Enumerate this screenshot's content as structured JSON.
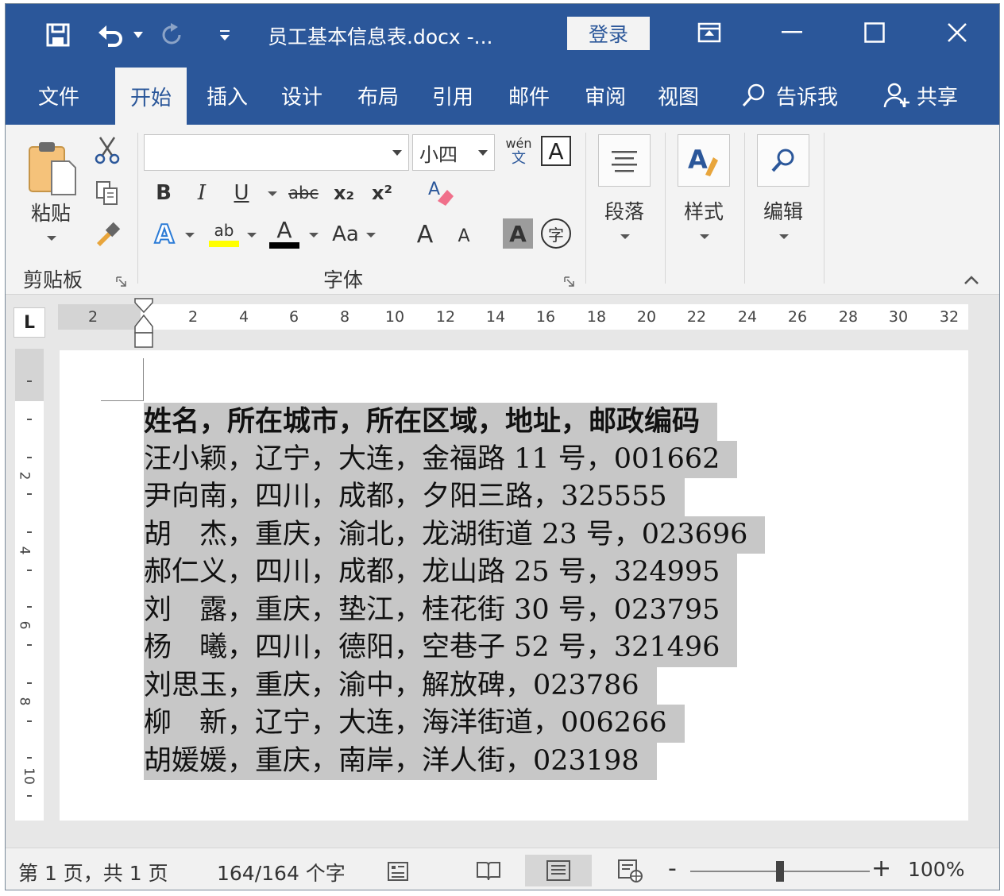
{
  "window": {
    "doc_title": "员工基本信息表.docx -...",
    "login_label": "登录",
    "colors": {
      "brand": "#2b579a",
      "selection": "#c7c7c7"
    }
  },
  "quick_access": {
    "icons": [
      "save-icon",
      "undo-icon",
      "redo-icon",
      "customize-icon"
    ]
  },
  "tabs": [
    {
      "label": "文件"
    },
    {
      "label": "开始",
      "active": true
    },
    {
      "label": "插入"
    },
    {
      "label": "设计"
    },
    {
      "label": "布局"
    },
    {
      "label": "引用"
    },
    {
      "label": "邮件"
    },
    {
      "label": "审阅"
    },
    {
      "label": "视图"
    },
    {
      "label": "告诉我"
    },
    {
      "label": "共享"
    }
  ],
  "ribbon": {
    "clipboard": {
      "paste_label": "粘贴",
      "group_label": "剪贴板"
    },
    "font": {
      "font_name_value": "",
      "font_size_value": "小四",
      "group_label": "字体",
      "phonetic_top": "wén",
      "phonetic_bottom": "文",
      "border_char": "A",
      "bold": "B",
      "italic": "I",
      "underline": "U",
      "strike": "abc",
      "subscript": "x₂",
      "superscript": "x²",
      "text_effect": "A",
      "highlight": "ab",
      "font_color": "A",
      "change_case": "Aa",
      "grow": "A",
      "shrink": "A",
      "shading": "A",
      "enclose": "字"
    },
    "paragraph": {
      "label": "段落"
    },
    "styles": {
      "label": "样式"
    },
    "editing": {
      "label": "编辑"
    }
  },
  "ruler": {
    "tab_selector": "L",
    "ticks": [
      "2",
      "2",
      "4",
      "6",
      "8",
      "10",
      "12",
      "14",
      "16",
      "18",
      "20",
      "22",
      "24",
      "26",
      "28",
      "30",
      "32"
    ],
    "vertical_ticks": [
      "2",
      "4",
      "6",
      "8",
      "10"
    ]
  },
  "document": {
    "lines": [
      "姓名，所在城市，所在区域，地址，邮政编码",
      "汪小颖，辽宁，大连，金福路 11 号，001662",
      "尹向南，四川，成都，夕阳三路，325555",
      "胡　杰，重庆，渝北，龙湖街道 23 号，023696",
      "郝仁义，四川，成都，龙山路 25 号，324995",
      "刘　露，重庆，垫江，桂花街 30 号，023795",
      "杨　曦，四川，德阳，空巷子 52 号，321496",
      "刘思玉，重庆，渝中，解放碑，023786",
      "柳　新，辽宁，大连，海洋街道，006266",
      "胡媛媛，重庆，南岸，洋人街，023198"
    ]
  },
  "status": {
    "page_info": "第 1 页，共 1 页",
    "word_count": "164/164 个字",
    "zoom_minus": "-",
    "zoom_plus": "+",
    "zoom_level": "100%"
  }
}
